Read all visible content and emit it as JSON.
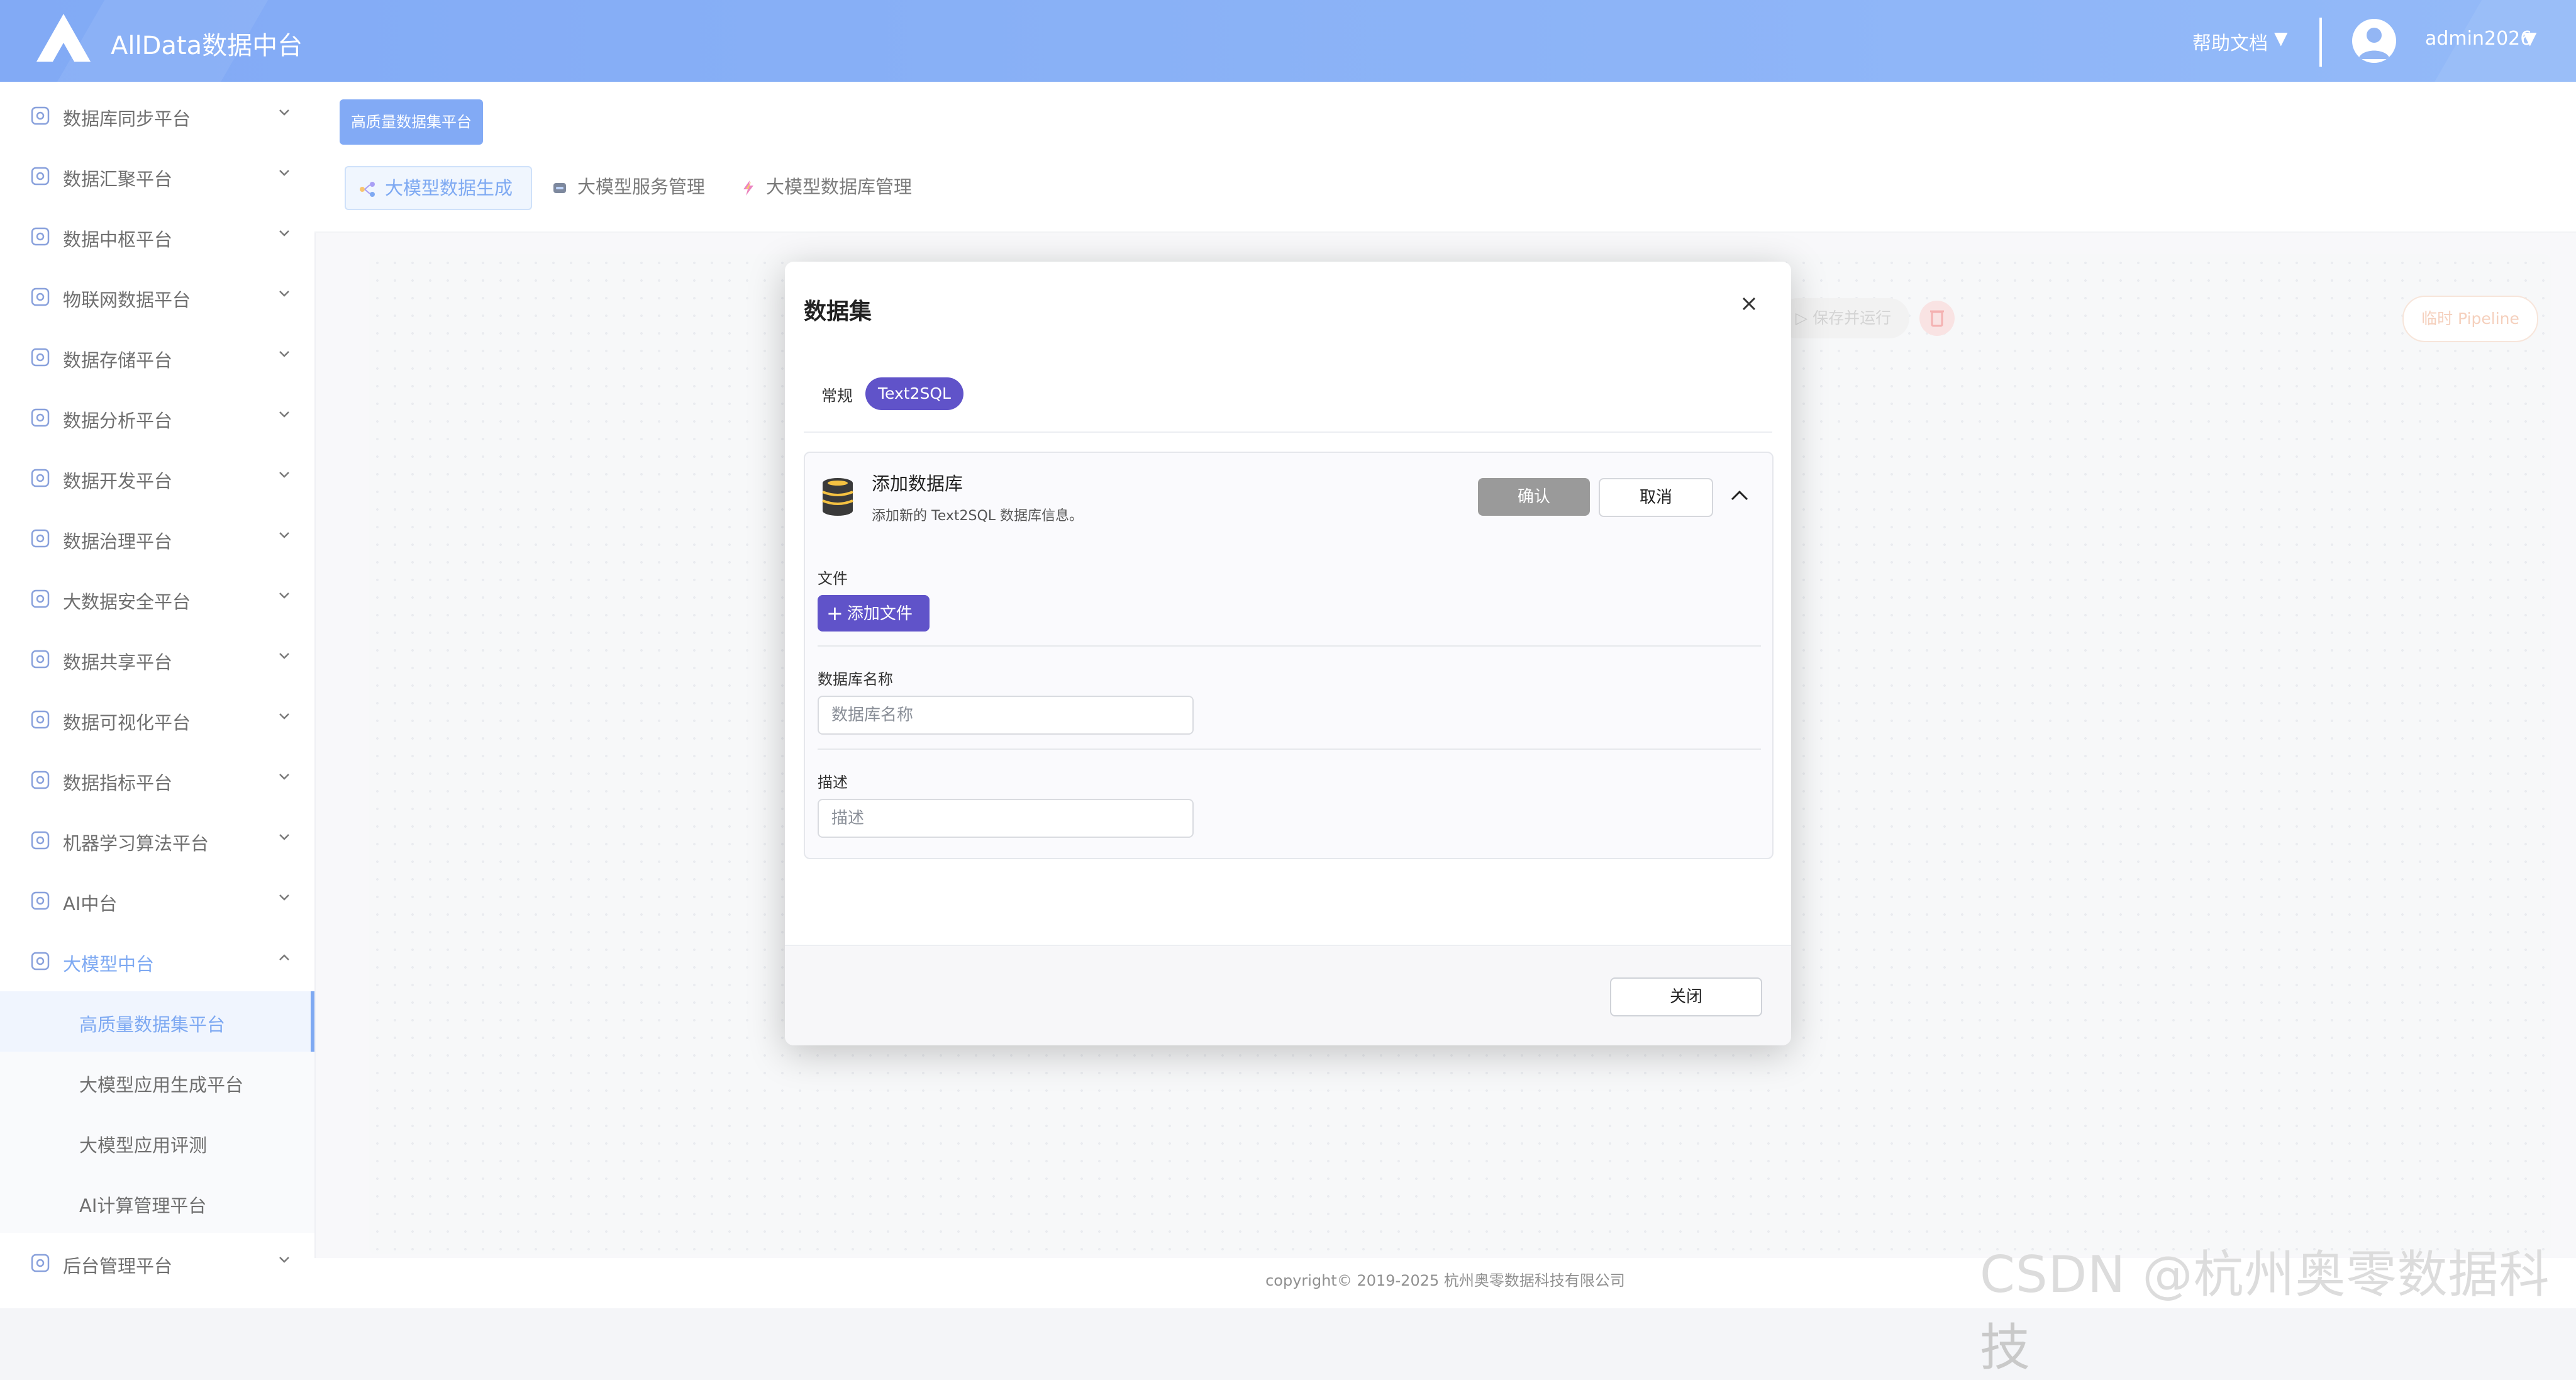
{
  "header": {
    "logo_text": "AllData数据中台",
    "help_label": "帮助文档",
    "caret": "▼",
    "username": "admin2026"
  },
  "sidebar": {
    "items": [
      {
        "label": "数据库同步平台",
        "icon": "sync-db-icon"
      },
      {
        "label": "数据汇聚平台",
        "icon": "layers-icon"
      },
      {
        "label": "数据中枢平台",
        "icon": "hub-icon"
      },
      {
        "label": "物联网数据平台",
        "icon": "iot-icon"
      },
      {
        "label": "数据存储平台",
        "icon": "storage-icon"
      },
      {
        "label": "数据分析平台",
        "icon": "analysis-icon"
      },
      {
        "label": "数据开发平台",
        "icon": "dev-icon"
      },
      {
        "label": "数据治理平台",
        "icon": "governance-icon"
      },
      {
        "label": "大数据安全平台",
        "icon": "security-icon"
      },
      {
        "label": "数据共享平台",
        "icon": "share-icon"
      },
      {
        "label": "数据可视化平台",
        "icon": "visualization-icon"
      },
      {
        "label": "数据指标平台",
        "icon": "metrics-icon"
      },
      {
        "label": "机器学习算法平台",
        "icon": "ml-icon"
      },
      {
        "label": "AI中台",
        "icon": "ai-icon"
      },
      {
        "label": "大模型中台",
        "icon": "llm-icon"
      }
    ],
    "subitems": [
      {
        "label": "高质量数据集平台"
      },
      {
        "label": "大模型应用生成平台"
      },
      {
        "label": "大模型应用评测"
      },
      {
        "label": "AI计算管理平台"
      }
    ],
    "bottom_item": {
      "label": "后台管理平台",
      "icon": "admin-icon"
    }
  },
  "breadcrumb_tag": "高质量数据集平台",
  "subtabs": [
    {
      "label": "大模型数据生成",
      "active": true
    },
    {
      "label": "大模型服务管理",
      "active": false
    },
    {
      "label": "大模型数据库管理",
      "active": false
    }
  ],
  "canvas": {
    "save_run": "保存并运行",
    "temp_pipeline": "临时 Pipeline"
  },
  "modal": {
    "title": "数据集",
    "tabs": [
      {
        "label": "常规",
        "active": false
      },
      {
        "label": "Text2SQL",
        "active": true
      }
    ],
    "panel": {
      "title": "添加数据库",
      "description": "添加新的 Text2SQL 数据库信息。",
      "confirm": "确认",
      "cancel": "取消"
    },
    "file_label": "文件",
    "add_file": "添加文件",
    "db_name_label": "数据库名称",
    "db_name_placeholder": "数据库名称",
    "desc_label": "描述",
    "desc_placeholder": "描述",
    "close": "关闭"
  },
  "footer": {
    "copyright": "copyright© 2019-2025 杭州奥零数据科技有限公司"
  },
  "watermark": "CSDN @杭州奥零数据科技",
  "colors": {
    "brand": "#3f7df0",
    "accent_purple": "#6053c9",
    "active_text": "#3a7cec"
  }
}
